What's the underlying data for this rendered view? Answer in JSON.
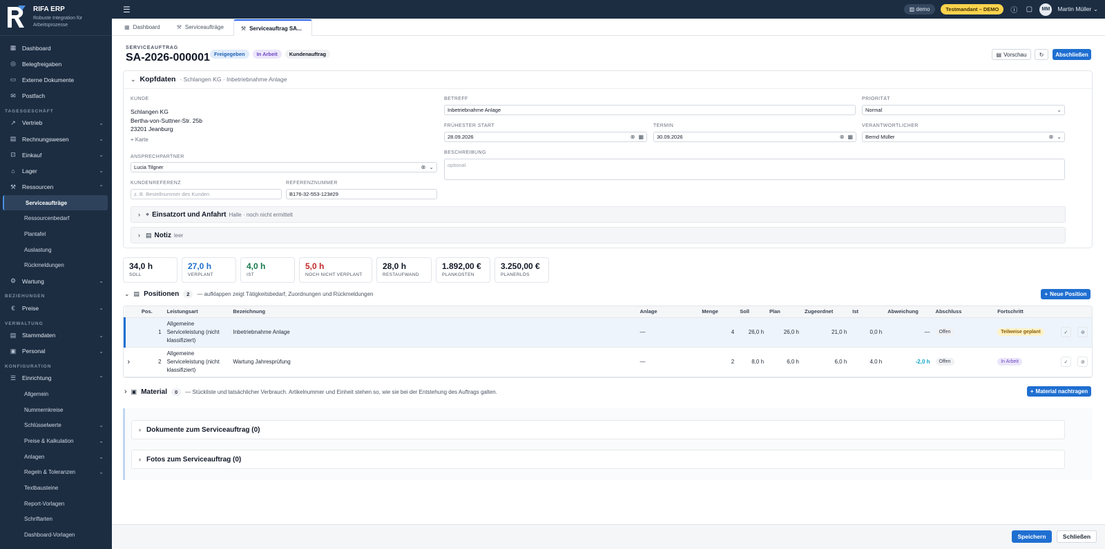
{
  "app": {
    "title": "RIFA ERP",
    "subtitle": "Robuste Integration für Arbeitsprozesse"
  },
  "sidebar": {
    "top": [
      {
        "label": "Dashboard"
      },
      {
        "label": "Belegfreigaben"
      },
      {
        "label": "Externe Dokumente"
      },
      {
        "label": "Postfach"
      }
    ],
    "sec_tages": "TAGESGESCHÄFT",
    "tages": [
      {
        "label": "Vertrieb"
      },
      {
        "label": "Rechnungswesen"
      },
      {
        "label": "Einkauf"
      },
      {
        "label": "Lager"
      },
      {
        "label": "Ressourcen"
      }
    ],
    "ressourcen_sub": [
      {
        "label": "Serviceaufträge"
      },
      {
        "label": "Ressourcenbedarf"
      },
      {
        "label": "Plantafel"
      },
      {
        "label": "Auslastung"
      },
      {
        "label": "Rückmeldungen"
      }
    ],
    "wartung": "Wartung",
    "sec_bez": "BEZIEHUNGEN",
    "preise": "Preise",
    "sec_verw": "VERWALTUNG",
    "verw": [
      {
        "label": "Stammdaten"
      },
      {
        "label": "Personal"
      }
    ],
    "sec_konf": "KONFIGURATION",
    "einrichtung": "Einrichtung",
    "einrichtung_sub": [
      {
        "label": "Allgemein"
      },
      {
        "label": "Nummernkreise"
      },
      {
        "label": "Schlüsselwerte"
      },
      {
        "label": "Preise & Kalkulation"
      },
      {
        "label": "Anlagen"
      },
      {
        "label": "Regeln & Toleranzen"
      },
      {
        "label": "Textbausteine"
      },
      {
        "label": "Report-Vorlagen"
      },
      {
        "label": "Schriftarten"
      },
      {
        "label": "Dashboard-Vorlagen"
      }
    ]
  },
  "topbar": {
    "tenant": "demo",
    "mandant": "Testmandant – DEMO",
    "avatar": "MM",
    "user": "Martin Müller"
  },
  "tabs": [
    {
      "label": "Dashboard"
    },
    {
      "label": "Serviceaufträge"
    },
    {
      "label": "Serviceauftrag SA..."
    }
  ],
  "header": {
    "kind": "SERVICEAUFTRAG",
    "number": "SA-2026-000001",
    "badges": [
      "Freigegeben",
      "In Arbeit",
      "Kundenauftrag"
    ],
    "preview": "Vorschau",
    "close_order": "Abschließen"
  },
  "kopf": {
    "title": "Kopfdaten",
    "crumb": "· Schlangen KG · Inbetriebnahme Anlage",
    "kunde_label": "KUNDE",
    "kunde_lines": [
      "Schlangen KG",
      "Bertha-von-Suttner-Str. 25b",
      "23201 Jeanburg"
    ],
    "karte": "Karte",
    "ansprech_label": "ANSPRECHPARTNER",
    "ansprech": "Lucia Tilgner",
    "kref_label": "KUNDENREFERENZ",
    "kref_ph": "z. B. Bestellnummer des Kunden",
    "refnr_label": "REFERENZNUMMER",
    "refnr": "B176-32-553-123#29",
    "betreff_label": "BETREFF",
    "betreff": "Inbetriebnahme Anlage",
    "prio_label": "PRIORITÄT",
    "prio": "Normal",
    "start_label": "FRÜHESTER START",
    "start": "28.09.2026",
    "termin_label": "TERMIN",
    "termin": "30.09.2026",
    "verantw_label": "VERANTWORTLICHER",
    "verantw": "Bernd Müller",
    "beschr_label": "BESCHREIBUNG",
    "beschr_ph": "optional",
    "einsatz_title": "Einsatzort und Anfahrt",
    "einsatz_sub": "Halle · noch nicht ermittelt",
    "notiz_title": "Notiz",
    "notiz_sub": "leer"
  },
  "kpis": [
    {
      "value": "34,0 h",
      "label": "SOLL",
      "color": "#111827"
    },
    {
      "value": "27,0 h",
      "label": "VERPLANT",
      "color": "#1e6fc9"
    },
    {
      "value": "4,0 h",
      "label": "IST",
      "color": "#16794a"
    },
    {
      "value": "5,0 h",
      "label": "NOCH NICHT VERPLANT",
      "color": "#c62828"
    },
    {
      "value": "28,0 h",
      "label": "RESTAUFWAND",
      "color": "#111827"
    },
    {
      "value": "1.892,00 €",
      "label": "PLANKOSTEN",
      "color": "#111827"
    },
    {
      "value": "3.250,00 €",
      "label": "PLANERLÖS",
      "color": "#111827"
    }
  ],
  "positionen": {
    "title": "Positionen",
    "count": "2",
    "hint": "— aufklappen zeigt Tätigkeitsbedarf, Zuordnungen und Rückmeldungen",
    "new_btn": "Neue Position",
    "columns": [
      "Pos.",
      "Leistungsart",
      "Bezeichnung",
      "Anlage",
      "Menge",
      "Soll",
      "Plan",
      "Zugeordnet",
      "Ist",
      "Abweichung",
      "Abschluss",
      "Fortschritt"
    ],
    "rows": [
      {
        "pos": "1",
        "art": "Allgemeine Serviceleistung (nicht klassifiziert)",
        "bez": "Inbetriebnahme Anlage",
        "anlage": "—",
        "menge": "4",
        "soll": "26,0 h",
        "plan": "26,0 h",
        "zug": "21,0 h",
        "ist": "0,0 h",
        "abw": "—",
        "abschluss": "Offen",
        "fortschritt": "Teilweise geplant"
      },
      {
        "pos": "2",
        "art": "Allgemeine Serviceleistung (nicht klassifiziert)",
        "bez": "Wartung Jahresprüfung",
        "anlage": "—",
        "menge": "2",
        "soll": "8,0 h",
        "plan": "6,0 h",
        "zug": "6,0 h",
        "ist": "4,0 h",
        "abw": "-2,0 h",
        "abschluss": "Offen",
        "fortschritt": "In Arbeit"
      }
    ]
  },
  "material": {
    "title": "Material",
    "count": "0",
    "hint": "— Stückliste und tatsächlicher Verbrauch. Artikelnummer und Einheit stehen so, wie sie bei der Entstehung des Auftrags galten.",
    "btn": "Material nachtragen"
  },
  "docs": {
    "title": "Dokumente zum Serviceauftrag (0)"
  },
  "fotos": {
    "title": "Fotos zum Serviceauftrag (0)"
  },
  "footer": {
    "save": "Speichern",
    "close": "Schließen"
  }
}
